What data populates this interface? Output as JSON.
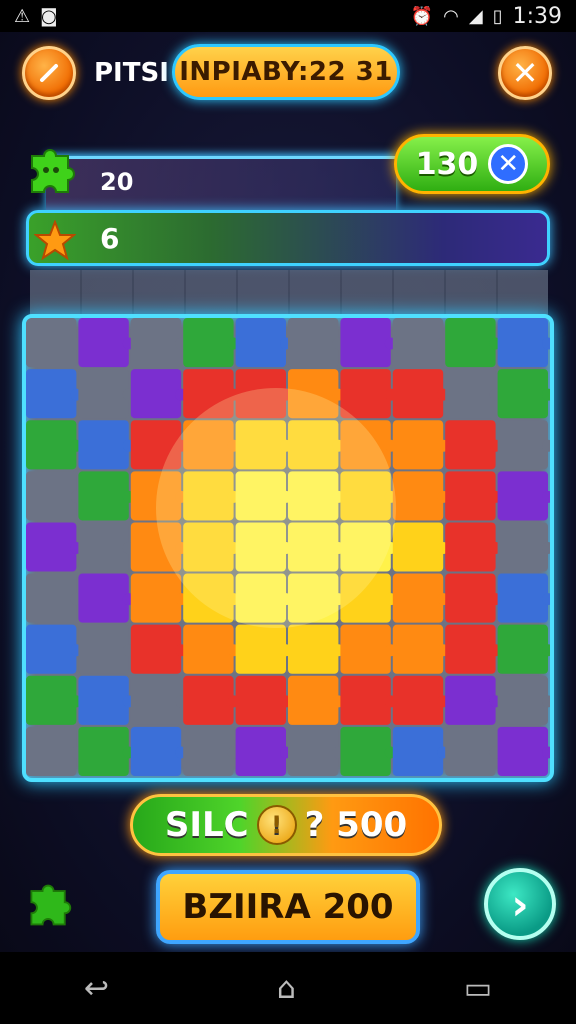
{
  "status_bar": {
    "time": "1:39",
    "left_icons": [
      "alert-triangle-icon",
      "android-icon"
    ],
    "right_icons": [
      "alarm-icon",
      "vibrate-icon",
      "wifi-icon",
      "signal-icon",
      "battery-icon"
    ]
  },
  "header": {
    "title": "PITSI",
    "timer_pill": "INPIABY:22 31",
    "edit_button_icon": "pencil-icon",
    "close_button_icon": "close-icon"
  },
  "progress": {
    "pieces_value": "20",
    "pieces_target": "130",
    "stars_value": "6"
  },
  "footer": {
    "score_left": "SILC",
    "score_right": "? 500",
    "buy_button": "BZIIRA 200",
    "next_button_icon": "chevron-right-icon"
  },
  "colors": {
    "accent_cyan": "#4fe0ff",
    "accent_orange": "#ff9a12",
    "accent_green": "#3fd21a"
  }
}
